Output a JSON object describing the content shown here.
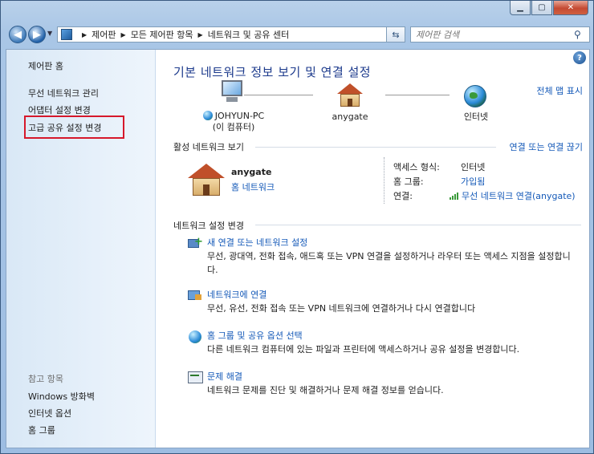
{
  "window": {
    "minimize_icon": "minimize-icon",
    "maximize_icon": "maximize-icon",
    "close_icon": "close-icon"
  },
  "navbar": {
    "back_icon": "back-arrow-icon",
    "forward_icon": "forward-arrow-icon",
    "breadcrumb": [
      "제어판",
      "모든 제어판 항목",
      "네트워크 및 공유 센터"
    ],
    "search_placeholder": "제어판 검색"
  },
  "sidebar": {
    "home": "제어판 홈",
    "items": [
      "무선 네트워크 관리",
      "어댑터 설정 변경",
      "고급 공유 설정 변경"
    ],
    "see_also_label": "참고 항목",
    "see_also": [
      "Windows 방화벽",
      "인터넷 옵션",
      "홈 그룹"
    ]
  },
  "main": {
    "title": "기본 네트워크 정보 보기 및 연결 설정",
    "full_map": "전체 맵 표시",
    "map": {
      "computer_name": "JOHYUN-PC",
      "computer_sub": "(이 컴퓨터)",
      "network": "anygate",
      "internet": "인터넷"
    },
    "active_networks_label": "활성 네트워크 보기",
    "connect_disconnect": "연결 또는 연결 끊기",
    "network": {
      "name": "anygate",
      "type": "홈 네트워크",
      "access_type_label": "액세스 형식:",
      "access_type_value": "인터넷",
      "homegroup_label": "홈 그룹:",
      "homegroup_value": "가입됨",
      "connections_label": "연결:",
      "connections_value": "무선 네트워크 연결(anygate)"
    },
    "change_settings_label": "네트워크 설정 변경",
    "tasks": [
      {
        "title": "새 연결 또는 네트워크 설정",
        "desc": "무선, 광대역, 전화 접속, 애드혹 또는 VPN 연결을 설정하거나 라우터 또는 액세스 지점을 설정합니다."
      },
      {
        "title": "네트워크에 연결",
        "desc": "무선, 유선, 전화 접속 또는 VPN 네트워크에 연결하거나 다시 연결합니다"
      },
      {
        "title": "홈 그룹 및 공유 옵션 선택",
        "desc": "다른 네트워크 컴퓨터에 있는 파일과 프린터에 액세스하거나 공유 설정을 변경합니다."
      },
      {
        "title": "문제 해결",
        "desc": "네트워크 문제를 진단 및 해결하거나 문제 해결 정보를 얻습니다."
      }
    ]
  },
  "colors": {
    "link": "#1459b8",
    "title": "#1c3a8c",
    "highlight_box": "#d6182b"
  }
}
